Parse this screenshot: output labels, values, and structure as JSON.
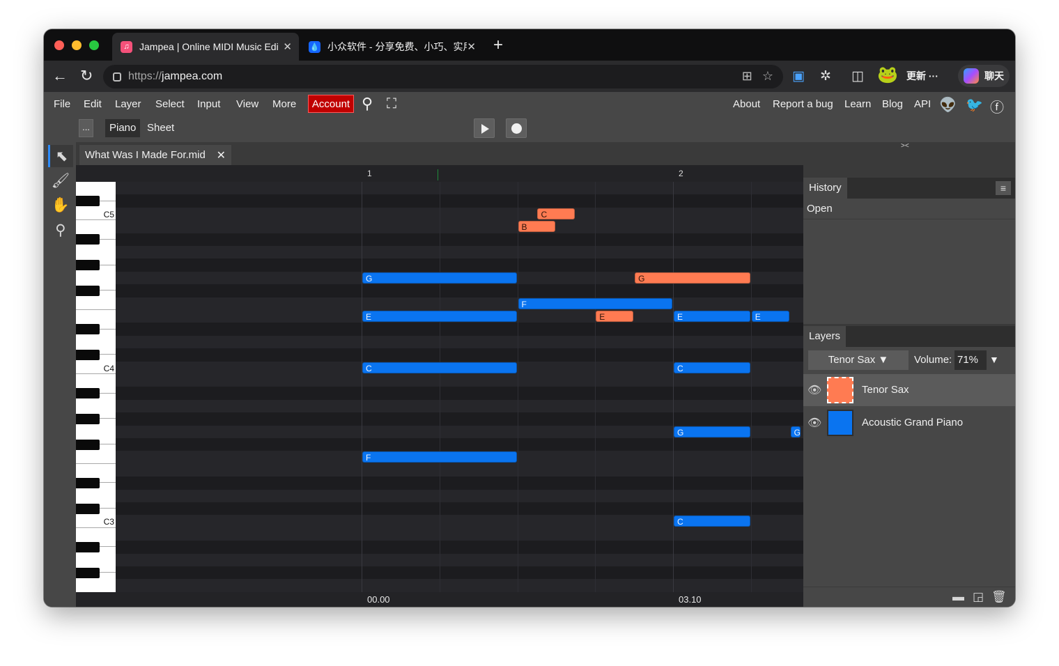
{
  "browser": {
    "tabs": [
      {
        "title": "Jampea | Online MIDI Music Edit",
        "favicon": "music-icon",
        "active": true
      },
      {
        "title": "小众软件 - 分享免费、小巧、实用",
        "favicon": "drop-icon",
        "active": false
      }
    ],
    "url_prefix": "https://",
    "url_host": "jampea.com",
    "update_label": "更新",
    "chat_label": "聊天"
  },
  "menu": {
    "items": [
      "File",
      "Edit",
      "Layer",
      "Select",
      "Input",
      "View",
      "More"
    ],
    "account": "Account",
    "links": [
      "About",
      "Report a bug",
      "Learn",
      "Blog",
      "API"
    ]
  },
  "toolbar": {
    "options_label": "...",
    "modes": [
      "Piano",
      "Sheet"
    ],
    "selected_mode": "Piano"
  },
  "document": {
    "filename": "What Was I Made For.mid"
  },
  "timeline": {
    "bars": [
      "1",
      "2"
    ],
    "times": [
      "00.00",
      "03.10"
    ]
  },
  "keyboard": {
    "labels": [
      "C5",
      "C4",
      "C3"
    ]
  },
  "notes": [
    {
      "label": "C",
      "pitch": "C5",
      "beat": 2.25,
      "length": 0.5,
      "layer": "Tenor Sax"
    },
    {
      "label": "B",
      "pitch": "B4",
      "beat": 2.0,
      "length": 0.5,
      "layer": "Tenor Sax"
    },
    {
      "label": "G",
      "pitch": "G4",
      "beat": 0.0,
      "length": 2.0,
      "layer": "Acoustic Grand Piano"
    },
    {
      "label": "G",
      "pitch": "G4",
      "beat": 3.5,
      "length": 1.5,
      "layer": "Tenor Sax"
    },
    {
      "label": "F",
      "pitch": "F4",
      "beat": 2.0,
      "length": 2.0,
      "layer": "Acoustic Grand Piano"
    },
    {
      "label": "E",
      "pitch": "E4",
      "beat": 0.0,
      "length": 2.0,
      "layer": "Acoustic Grand Piano"
    },
    {
      "label": "E",
      "pitch": "E4",
      "beat": 3.0,
      "length": 0.5,
      "layer": "Tenor Sax"
    },
    {
      "label": "E",
      "pitch": "E4",
      "beat": 4.0,
      "length": 1.0,
      "layer": "Acoustic Grand Piano"
    },
    {
      "label": "E",
      "pitch": "E4",
      "beat": 5.0,
      "length": 0.5,
      "layer": "Acoustic Grand Piano"
    },
    {
      "label": "C",
      "pitch": "C4",
      "beat": 0.0,
      "length": 2.0,
      "layer": "Acoustic Grand Piano"
    },
    {
      "label": "C",
      "pitch": "C4",
      "beat": 4.0,
      "length": 1.0,
      "layer": "Acoustic Grand Piano"
    },
    {
      "label": "G",
      "pitch": "G3",
      "beat": 4.0,
      "length": 1.0,
      "layer": "Acoustic Grand Piano"
    },
    {
      "label": "G",
      "pitch": "G3",
      "beat": 5.5,
      "length": 0.15,
      "layer": "Acoustic Grand Piano"
    },
    {
      "label": "F",
      "pitch": "F3",
      "beat": 0.0,
      "length": 2.0,
      "layer": "Acoustic Grand Piano"
    },
    {
      "label": "C",
      "pitch": "C3",
      "beat": 4.0,
      "length": 1.0,
      "layer": "Acoustic Grand Piano"
    }
  ],
  "history": {
    "title": "History",
    "items": [
      "Open"
    ]
  },
  "layers": {
    "title": "Layers",
    "selected_instrument": "Tenor Sax",
    "volume_label": "Volume:",
    "volume_value": "71%",
    "list": [
      {
        "name": "Tenor Sax",
        "color": "#ff7b52",
        "selected": true
      },
      {
        "name": "Acoustic Grand Piano",
        "color": "#0a74f0",
        "selected": false
      }
    ]
  }
}
